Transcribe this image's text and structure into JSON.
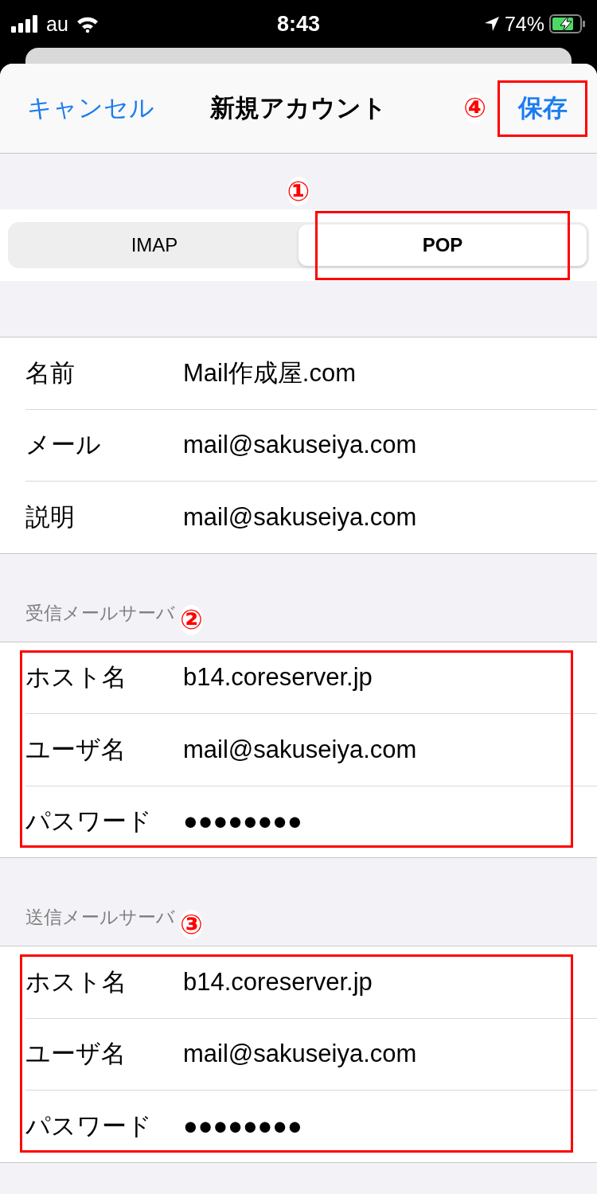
{
  "status_bar": {
    "carrier": "au",
    "time": "8:43",
    "battery": "74%"
  },
  "nav": {
    "cancel": "キャンセル",
    "title": "新規アカウント",
    "save": "保存",
    "save_marker": "④"
  },
  "segment": {
    "marker": "①",
    "options": [
      {
        "label": "IMAP",
        "selected": false
      },
      {
        "label": "POP",
        "selected": true
      }
    ]
  },
  "account_rows": [
    {
      "label": "名前",
      "value": "Mail作成屋.com"
    },
    {
      "label": "メール",
      "value": "mail@sakuseiya.com"
    },
    {
      "label": "説明",
      "value": "mail@sakuseiya.com"
    }
  ],
  "sections": [
    {
      "header": "受信メールサーバ",
      "marker": "②",
      "rows": [
        {
          "label": "ホスト名",
          "value": "b14.coreserver.jp"
        },
        {
          "label": "ユーザ名",
          "value": "mail@sakuseiya.com"
        },
        {
          "label": "パスワード",
          "value": "●●●●●●●●"
        }
      ]
    },
    {
      "header": "送信メールサーバ",
      "marker": "③",
      "rows": [
        {
          "label": "ホスト名",
          "value": "b14.coreserver.jp"
        },
        {
          "label": "ユーザ名",
          "value": "mail@sakuseiya.com"
        },
        {
          "label": "パスワード",
          "value": "●●●●●●●●"
        }
      ]
    }
  ]
}
